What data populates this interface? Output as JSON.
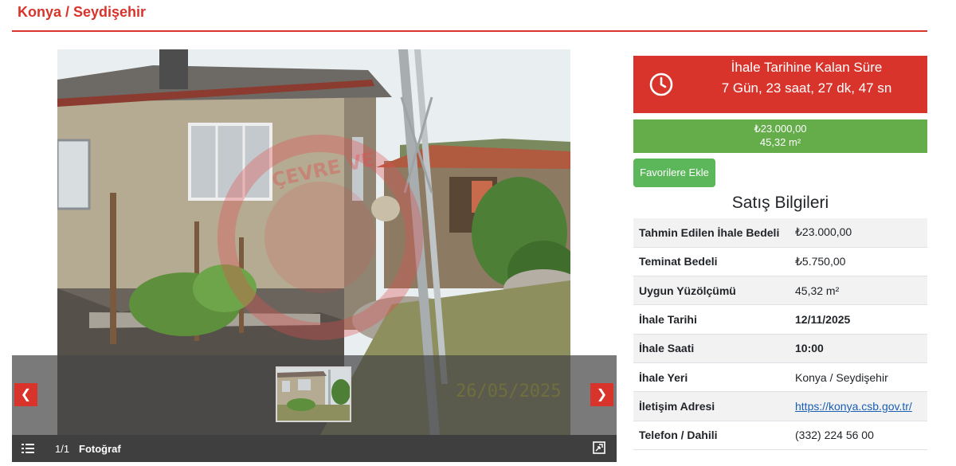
{
  "header": {
    "title": "Konya / Seydişehir"
  },
  "gallery": {
    "counter": "1/1",
    "label": "Fotoğraf",
    "date_stamp": "26/05/2025",
    "watermark_text": "ÇEVRE VE"
  },
  "countdown": {
    "title": "İhale Tarihine Kalan Süre",
    "value": "7 Gün, 23 saat, 27 dk, 47 sn"
  },
  "price": {
    "amount": "₺23.000,00",
    "area": "45,32 m²"
  },
  "favorite_button": "Favorilere Ekle",
  "section_title": "Satış Bilgileri",
  "info": [
    {
      "label": "Tahmin Edilen İhale Bedeli",
      "value": "₺23.000,00"
    },
    {
      "label": "Teminat Bedeli",
      "value": "₺5.750,00"
    },
    {
      "label": "Uygun Yüzölçümü",
      "value": "45,32 m²"
    },
    {
      "label": "İhale Tarihi",
      "value": "12/11/2025"
    },
    {
      "label": "İhale Saati",
      "value": "10:00"
    },
    {
      "label": "İhale Yeri",
      "value": "Konya / Seydişehir"
    },
    {
      "label": "İletişim Adresi",
      "value": "https://konya.csb.gov.tr/"
    },
    {
      "label": "Telefon / Dahili",
      "value": "(332) 224 56 00"
    }
  ]
}
